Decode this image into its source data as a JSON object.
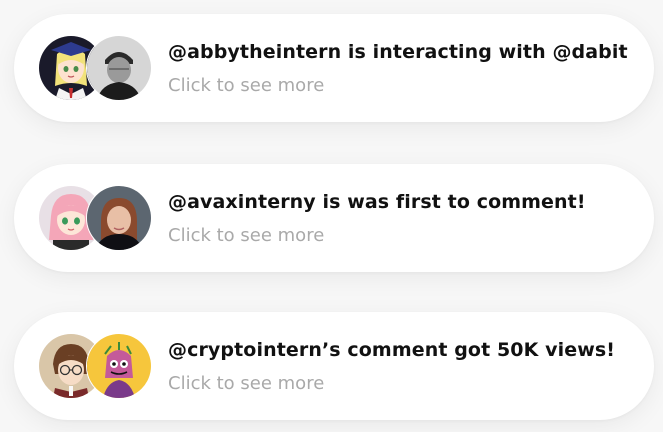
{
  "notifications": [
    {
      "title": "@abbytheintern is interacting with @dabit",
      "subtitle": "Click to see more",
      "avatars": [
        "anime-student-graduate-icon",
        "man-beanie-photo"
      ]
    },
    {
      "title": "@avaxinterny is was first to comment!",
      "subtitle": "Click to see more",
      "avatars": [
        "anime-girl-pink-hair-icon",
        "woman-red-hair-photo"
      ]
    },
    {
      "title": "@cryptointern’s comment got 50K views!",
      "subtitle": "Click to see more",
      "avatars": [
        "anime-boy-glasses-icon",
        "yellow-nft-character-icon"
      ]
    }
  ]
}
